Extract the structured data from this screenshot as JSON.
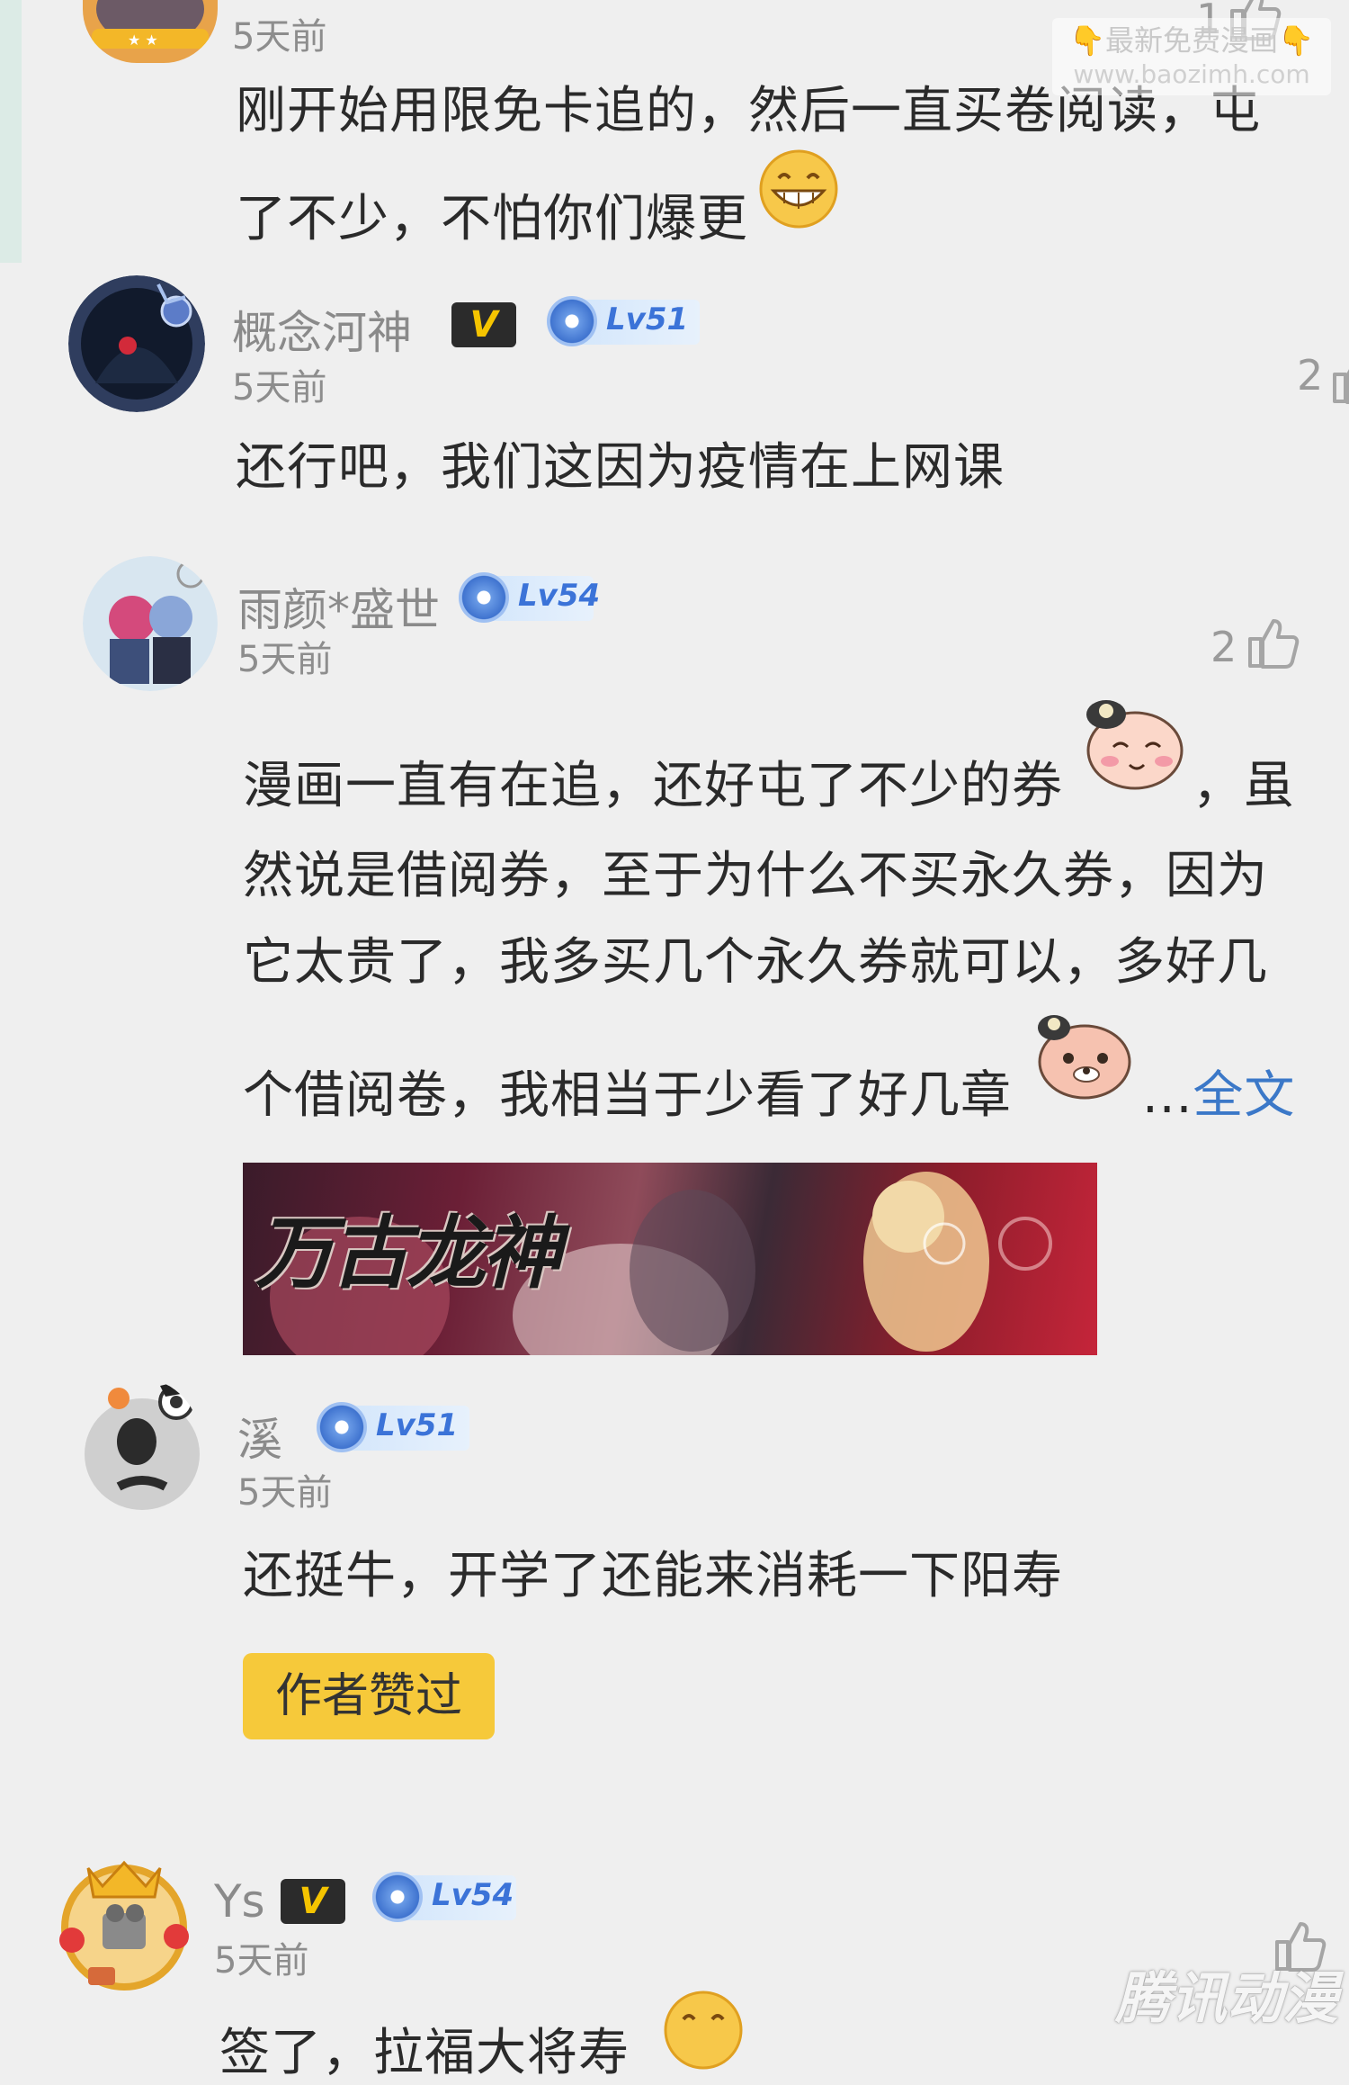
{
  "watermark": {
    "top_line": "👇最新免费漫画👇",
    "url": "www.baozimh.com",
    "bottom_brand": "腾讯动漫"
  },
  "comments": [
    {
      "username": "",
      "time": "5天前",
      "likes": "1",
      "lines": [
        "刚开始用限免卡追的，然后一直买卷阅读，屯",
        "了不少，不怕你们爆更"
      ]
    },
    {
      "username": "概念河神",
      "vip": "V",
      "level": "Lv51",
      "time": "5天前",
      "likes": "2",
      "lines": [
        "还行吧，我们这因为疫情在上网课"
      ]
    },
    {
      "username": "雨颜*盛世",
      "level": "Lv54",
      "time": "5天前",
      "likes": "2",
      "lines": [
        "漫画一直有在追，还好屯了不少的券",
        "，虽",
        "然说是借阅券，至于为什么不买永久券，因为",
        "它太贵了，我多买几个永久券就可以，多好几",
        "个借阅卷，我相当于少看了好几章"
      ],
      "more_prefix": "...",
      "more_label": "全文",
      "banner_title": "万古龙神"
    },
    {
      "username": "溪",
      "level": "Lv51",
      "time": "5天前",
      "lines": [
        "还挺牛，开学了还能来消耗一下阳寿"
      ],
      "author_liked": "作者赞过"
    },
    {
      "username": "Ys",
      "vip": "V",
      "level": "Lv54",
      "time": "5天前",
      "lines": [
        "签了，拉福大将寿"
      ]
    }
  ]
}
